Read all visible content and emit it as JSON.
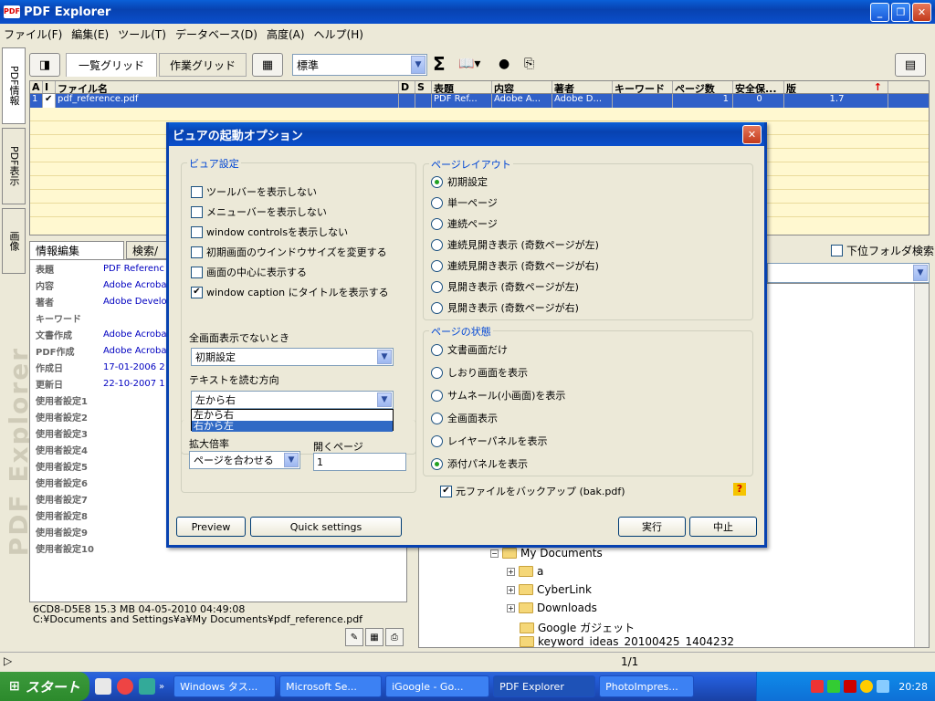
{
  "app": {
    "title": "PDF Explorer",
    "icon_label": "PDF",
    "window_buttons": [
      "_",
      "❐",
      "✕"
    ]
  },
  "menu": [
    "ファイル(F)",
    "編集(E)",
    "ツール(T)",
    "データベース(D)",
    "高度(A)",
    "ヘルプ(H)"
  ],
  "side_tabs": [
    "PDF情報",
    "PDF表示",
    "画像"
  ],
  "side_brand": "PDF Explorer",
  "toolbar": {
    "tab_list": "一覧グリッド",
    "tab_work": "作業グリッド",
    "preset": "標準"
  },
  "grid": {
    "columns": [
      "A",
      "I",
      "ファイル名",
      "D",
      "S",
      "表題",
      "内容",
      "著者",
      "キーワード",
      "ページ数",
      "安全保...",
      "版"
    ],
    "row": {
      "num": "1",
      "check": "✔",
      "filename": "pdf_reference.pdf",
      "title": "PDF Ref...",
      "content": "Adobe A...",
      "author": "Adobe D...",
      "keywords": "",
      "pages": "1",
      "security": "0",
      "version": "1.7"
    }
  },
  "info_tabs": [
    "情報編集",
    "検索/"
  ],
  "info_rows": [
    {
      "k": "表題",
      "v": "PDF Referenc"
    },
    {
      "k": "内容",
      "v": "Adobe Acroba"
    },
    {
      "k": "著者",
      "v": "Adobe Develop"
    },
    {
      "k": "キーワード",
      "v": ""
    },
    {
      "k": "文書作成",
      "v": "Adobe Acroba"
    },
    {
      "k": "PDF作成",
      "v": "Adobe Acroba"
    },
    {
      "k": "作成日",
      "v": "17-01-2006 2"
    },
    {
      "k": "更新日",
      "v": "22-10-2007 1"
    },
    {
      "k": "使用者設定1",
      "v": ""
    },
    {
      "k": "使用者設定2",
      "v": ""
    },
    {
      "k": "使用者設定3",
      "v": ""
    },
    {
      "k": "使用者設定4",
      "v": ""
    },
    {
      "k": "使用者設定5",
      "v": ""
    },
    {
      "k": "使用者設定6",
      "v": ""
    },
    {
      "k": "使用者設定7",
      "v": ""
    },
    {
      "k": "使用者設定8",
      "v": ""
    },
    {
      "k": "使用者設定9",
      "v": ""
    },
    {
      "k": "使用者設定10",
      "v": ""
    }
  ],
  "file_status": {
    "line1": "6CD8-D5E8      15.3 MB   04-05-2010 04:49:08",
    "line2": "C:¥Documents and Settings¥a¥My Documents¥pdf_reference.pdf"
  },
  "subfolder_search": "下位フォルダ検索",
  "tree": [
    "My Documents",
    "a",
    "CyberLink",
    "Downloads",
    "Google ガジェット",
    "keyword_ideas_20100425_1404232"
  ],
  "page_indicator": "1/1",
  "dialog": {
    "title": "ビュアの起動オプション",
    "viewer_group": "ビュア設定",
    "viewer_options": [
      {
        "label": "ツールバーを表示しない",
        "checked": false
      },
      {
        "label": "メニューバーを表示しない",
        "checked": false
      },
      {
        "label": "window controlsを表示しない",
        "checked": false
      },
      {
        "label": "初期画面のウインドウサイズを変更する",
        "checked": false
      },
      {
        "label": "画面の中心に表示する",
        "checked": false
      },
      {
        "label": "window caption にタイトルを表示する",
        "checked": true
      }
    ],
    "fullscreen_label": "全画面表示でないとき",
    "fullscreen_value": "初期設定",
    "direction_label": "テキストを読む方向",
    "direction_value": "左から右",
    "direction_options": [
      "左から右",
      "右から左"
    ],
    "zoom_label": "拡大倍率",
    "zoom_value": "ページを合わせる",
    "open_page_label": "開くページ",
    "open_page_value": "1",
    "layout_group": "ページレイアウト",
    "layout_options": [
      {
        "label": "初期設定",
        "selected": true
      },
      {
        "label": "単一ページ",
        "selected": false
      },
      {
        "label": "連続ページ",
        "selected": false
      },
      {
        "label": "連続見開き表示 (奇数ページが左)",
        "selected": false
      },
      {
        "label": "連続見開き表示 (奇数ページが右)",
        "selected": false
      },
      {
        "label": "見開き表示 (奇数ページが左)",
        "selected": false
      },
      {
        "label": "見開き表示 (奇数ページが右)",
        "selected": false
      }
    ],
    "state_group": "ページの状態",
    "state_options": [
      {
        "label": "文書画面だけ",
        "selected": false
      },
      {
        "label": "しおり画面を表示",
        "selected": false
      },
      {
        "label": "サムネール(小画面)を表示",
        "selected": false
      },
      {
        "label": "全画面表示",
        "selected": false
      },
      {
        "label": "レイヤーパネルを表示",
        "selected": false
      },
      {
        "label": "添付パネルを表示",
        "selected": true
      }
    ],
    "backup_label": "元ファイルをバックアップ (bak.pdf)",
    "backup_checked": true,
    "help_icon": "?",
    "btn_preview": "Preview",
    "btn_quick": "Quick settings",
    "btn_run": "実行",
    "btn_cancel": "中止"
  },
  "taskbar": {
    "start": "スタート",
    "tasks": [
      "Windows タス...",
      "Microsoft Se...",
      "iGoogle - Go...",
      "PDF Explorer",
      "PhotoImpres..."
    ],
    "clock": "20:28"
  }
}
